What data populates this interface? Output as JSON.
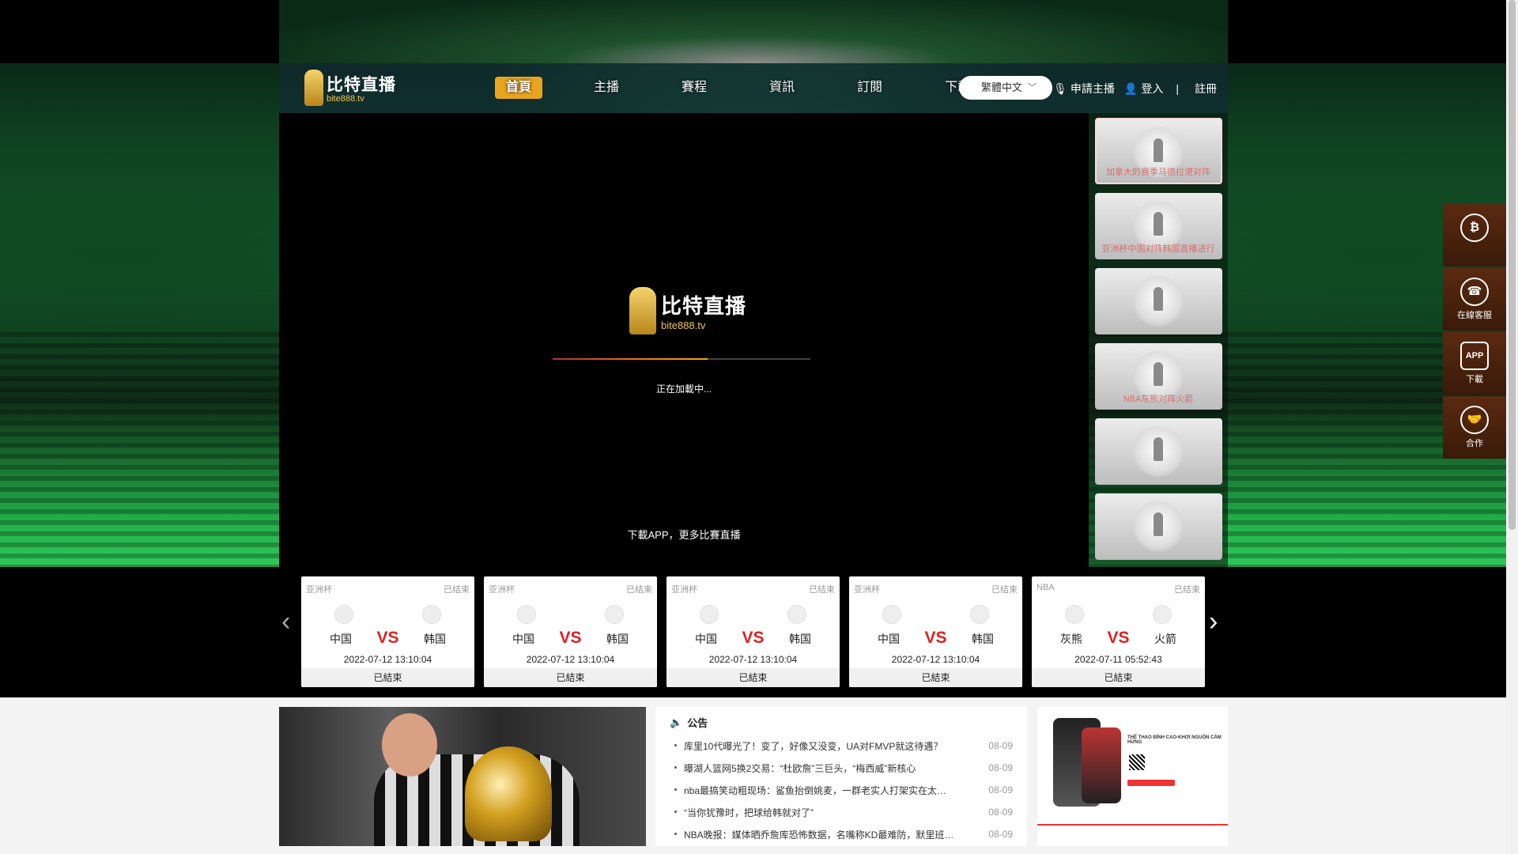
{
  "header": {
    "logo": {
      "cn": "比特直播",
      "en": "bite888.tv"
    },
    "nav": [
      {
        "label": "首頁",
        "active": true
      },
      {
        "label": "主播"
      },
      {
        "label": "賽程"
      },
      {
        "label": "資訊"
      },
      {
        "label": "訂閱"
      },
      {
        "label": "下載APP"
      }
    ],
    "language": "繁體中文",
    "apply_host": "申請主播",
    "login": "登入",
    "separator": "|",
    "register": "註冊"
  },
  "video": {
    "loading_text": "正在加載中...",
    "bottom_text": "下載APP，更多比賽直播",
    "progress_percent": 60
  },
  "sidelist": {
    "items": [
      {
        "name": "加拿大的赛季马德拉港对阵"
      },
      {
        "name": "亚洲杯中国对阵韩国直播进行"
      },
      {
        "name": ""
      },
      {
        "name": "NBA灰熊对阵火箭"
      },
      {
        "name": ""
      },
      {
        "name": ""
      }
    ]
  },
  "floaters": [
    {
      "label": "",
      "icon": "bitcoin-cup-icon"
    },
    {
      "label": "在線客服",
      "icon": "headset-icon"
    },
    {
      "label": "下載",
      "icon": "app-icon"
    },
    {
      "label": "合作",
      "icon": "handshake-icon"
    }
  ],
  "matches": [
    {
      "league": "亚洲杯",
      "status_top": "已结束",
      "home": "中国",
      "away": "韩国",
      "vs": "VS",
      "time": "2022-07-12 13:10:04",
      "status": "已結束"
    },
    {
      "league": "亚洲杯",
      "status_top": "已结束",
      "home": "中国",
      "away": "韩国",
      "vs": "VS",
      "time": "2022-07-12 13:10:04",
      "status": "已結束"
    },
    {
      "league": "亚洲杯",
      "status_top": "已结束",
      "home": "中国",
      "away": "韩国",
      "vs": "VS",
      "time": "2022-07-12 13:10:04",
      "status": "已結束"
    },
    {
      "league": "亚洲杯",
      "status_top": "已结束",
      "home": "中国",
      "away": "韩国",
      "vs": "VS",
      "time": "2022-07-12 13:10:04",
      "status": "已結束"
    },
    {
      "league": "NBA",
      "status_top": "已结束",
      "home": "灰熊",
      "away": "火箭",
      "vs": "VS",
      "time": "2022-07-11 05:52:43",
      "status": "已結束"
    }
  ],
  "notice": {
    "title": "公告",
    "items": [
      {
        "text": "库里10代曝光了！变了，好像又没变，UA对FMVP就这待遇？",
        "date": "08-09"
      },
      {
        "text": "曝湖人篮网5换2交易：“杜欧詹”三巨头，“梅西威”新核心",
        "date": "08-09"
      },
      {
        "text": "nba最搞笑动粗现场：鲨鱼抬倒姚麦，一群老实人打架实在太有意思了",
        "date": "08-09"
      },
      {
        "text": "“当你犹豫时，把球给韩就对了”",
        "date": "08-09"
      },
      {
        "text": "NBA晚报：媒体晒乔詹库恐怖数据，名嘴称KD最难防，默里班切斯特",
        "date": "08-09"
      }
    ]
  },
  "app_ad": {
    "headline": "THỂ THAO ĐỈNH CAO-KHƠI NGUỒN CẢM HỨNG"
  }
}
